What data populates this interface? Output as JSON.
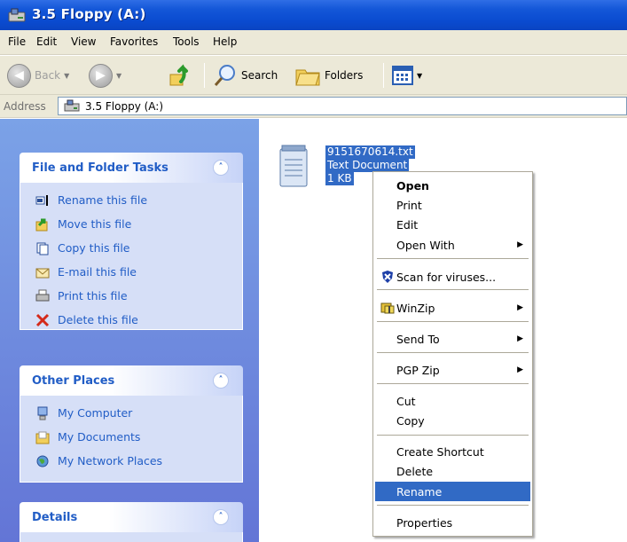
{
  "window": {
    "title": "3.5 Floppy (A:)"
  },
  "menu": [
    "File",
    "Edit",
    "View",
    "Favorites",
    "Tools",
    "Help"
  ],
  "toolbar": {
    "back_label": "Back",
    "search_label": "Search",
    "folders_label": "Folders"
  },
  "address": {
    "label": "Address",
    "value": "3.5 Floppy (A:)"
  },
  "tasks_panel": {
    "title": "File and Folder Tasks",
    "items": [
      {
        "label": "Rename this file",
        "icon": "rename-icon"
      },
      {
        "label": "Move this file",
        "icon": "move-icon"
      },
      {
        "label": "Copy this file",
        "icon": "copy-icon"
      },
      {
        "label": "E-mail this file",
        "icon": "email-icon"
      },
      {
        "label": "Print this file",
        "icon": "printer-icon"
      },
      {
        "label": "Delete this file",
        "icon": "delete-x-icon"
      }
    ]
  },
  "places_panel": {
    "title": "Other Places",
    "items": [
      {
        "label": "My Computer",
        "icon": "my-computer-icon"
      },
      {
        "label": "My Documents",
        "icon": "my-documents-icon"
      },
      {
        "label": "My Network Places",
        "icon": "network-places-icon"
      }
    ]
  },
  "details_panel": {
    "title": "Details"
  },
  "file": {
    "name": "9151670614.txt",
    "type": "Text Document",
    "size": "1 KB"
  },
  "context_menu": {
    "open": "Open",
    "print": "Print",
    "edit": "Edit",
    "open_with": "Open With",
    "scan": "Scan for viruses...",
    "winzip": "WinZip",
    "send_to": "Send To",
    "pgp_zip": "PGP Zip",
    "cut": "Cut",
    "copy": "Copy",
    "create_shortcut": "Create Shortcut",
    "delete": "Delete",
    "rename": "Rename",
    "properties": "Properties"
  },
  "colors": {
    "title_bar": "#0a4bd0",
    "selection": "#316ac5",
    "task_link": "#215dc6",
    "pane_bg": "#7ba2e7"
  }
}
